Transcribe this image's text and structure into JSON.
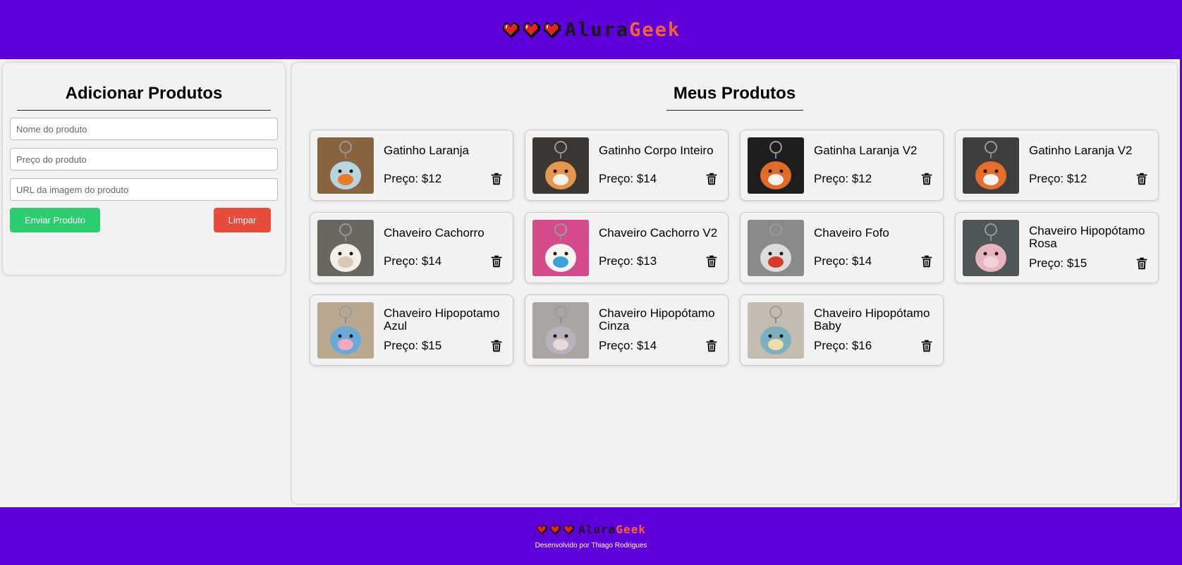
{
  "header": {
    "brand_prefix": "Alura",
    "brand_suffix": "Geek"
  },
  "form": {
    "title": "Adicionar Produtos",
    "name_placeholder": "Nome do produto",
    "price_placeholder": "Preço do produto",
    "image_placeholder": "URL da imagem do produto",
    "send_label": "Enviar Produto",
    "clear_label": "Limpar"
  },
  "products": {
    "title": "Meus Produtos",
    "items": [
      {
        "name": "Gatinho Laranja",
        "price": "Preço: $12",
        "bg": "#8a6440",
        "figure": "#b8d4dc",
        "accent": "#e87a2a"
      },
      {
        "name": "Gatinho Corpo Inteiro",
        "price": "Preço: $14",
        "bg": "#3a3632",
        "figure": "#e49650",
        "accent": "#f4f0ea"
      },
      {
        "name": "Gatinha Laranja V2",
        "price": "Preço: $12",
        "bg": "#1e1e1e",
        "figure": "#e26b2a",
        "accent": "#f6f2ea"
      },
      {
        "name": "Gatinho Laranja V2",
        "price": "Preço: $12",
        "bg": "#3e3e3e",
        "figure": "#e56e2c",
        "accent": "#f4f4f4"
      },
      {
        "name": "Chaveiro Cachorro",
        "price": "Preço: $14",
        "bg": "#6a6660",
        "figure": "#f2efe8",
        "accent": "#d8c8b4"
      },
      {
        "name": "Chaveiro Cachorro V2",
        "price": "Preço: $13",
        "bg": "#d44a8a",
        "figure": "#f6f4f0",
        "accent": "#3aa2d8"
      },
      {
        "name": "Chaveiro Fofo",
        "price": "Preço: $14",
        "bg": "#8a8a88",
        "figure": "#dcdcdc",
        "accent": "#d63a2a"
      },
      {
        "name": "Chaveiro Hipopótamo Rosa",
        "price": "Preço: $15",
        "bg": "#4e5658",
        "figure": "#e8b4c0",
        "accent": "#f2d0d8"
      },
      {
        "name": "Chaveiro Hipopotamo Azul",
        "price": "Preço: $15",
        "bg": "#b8a890",
        "figure": "#6aa8d8",
        "accent": "#f0a8c0"
      },
      {
        "name": "Chaveiro Hipopótamo Cinza",
        "price": "Preço: $14",
        "bg": "#a8a4a0",
        "figure": "#b8b0bc",
        "accent": "#e8d8dc"
      },
      {
        "name": "Chaveiro Hipopótamo Baby",
        "price": "Preço: $16",
        "bg": "#c4bcb0",
        "figure": "#7cb0c0",
        "accent": "#f0dca8"
      }
    ]
  },
  "footer": {
    "brand_prefix": "Alura",
    "brand_suffix": "Geek",
    "credit": "Desenvolvido por Thiago Rodrigues"
  },
  "colors": {
    "header_bg": "#5f00db",
    "send_button": "#2ecc71",
    "clear_button": "#e74c3c",
    "brand_accent": "#f2623a"
  }
}
